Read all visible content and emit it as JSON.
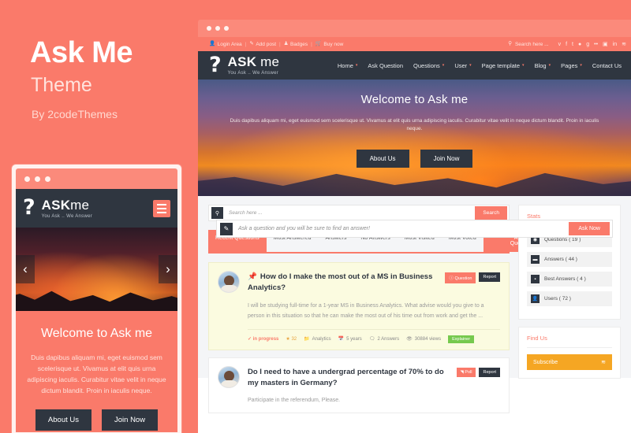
{
  "promo": {
    "title": "Ask Me",
    "subtitle": "Theme",
    "byline": "By 2codeThemes"
  },
  "mobile": {
    "logo_mark": "?",
    "logo_name_bold": "ASK",
    "logo_name_light": "me",
    "logo_tagline": "You Ask .. We Answer",
    "menu_icon": "hamburger-icon",
    "prev_arrow": "‹",
    "next_arrow": "›",
    "hero_title": "Welcome to Ask me",
    "hero_text": "Duis dapibus aliquam mi, eget euismod sem scelerisque ut. Vivamus at elit quis urna adipiscing iaculis. Curabitur vitae velit in neque dictum blandit. Proin in iaculis neque.",
    "btn_about": "About Us",
    "btn_join": "Join Now"
  },
  "topbar": {
    "items": [
      {
        "icon": "user-icon",
        "glyph": "👤",
        "label": "Login Area"
      },
      {
        "icon": "pencil-icon",
        "glyph": "✎",
        "label": "Add post"
      },
      {
        "icon": "badge-icon",
        "glyph": "♟",
        "label": "Badges"
      },
      {
        "icon": "cart-icon",
        "glyph": "🛒",
        "label": "Buy now"
      }
    ],
    "separator": "|",
    "search_icon": "search-icon",
    "search_placeholder": "Search here ...",
    "socials": [
      {
        "name": "twitter-icon",
        "glyph": "ᴠ"
      },
      {
        "name": "facebook-icon",
        "glyph": "f"
      },
      {
        "name": "tumblr-icon",
        "glyph": "t"
      },
      {
        "name": "dribbble-icon",
        "glyph": "●"
      },
      {
        "name": "google-plus-icon",
        "glyph": "g"
      },
      {
        "name": "flickr-icon",
        "glyph": "••"
      },
      {
        "name": "instagram-icon",
        "glyph": "▣"
      },
      {
        "name": "linkedin-icon",
        "glyph": "in"
      },
      {
        "name": "rss-icon",
        "glyph": "≋"
      }
    ]
  },
  "nav": {
    "logo_mark": "?",
    "logo_name_bold": "ASK",
    "logo_name_light": "me",
    "logo_tagline": "You Ask .. We Answer",
    "menu": [
      {
        "label": "Home",
        "caret": true
      },
      {
        "label": "Ask Question",
        "caret": false
      },
      {
        "label": "Questions",
        "caret": true
      },
      {
        "label": "User",
        "caret": true
      },
      {
        "label": "Page template",
        "caret": true
      },
      {
        "label": "Blog",
        "caret": true
      },
      {
        "label": "Pages",
        "caret": true
      },
      {
        "label": "Contact Us",
        "caret": false
      }
    ],
    "caret_glyph": "▾"
  },
  "hero": {
    "title": "Welcome to Ask me",
    "text": "Duis dapibus aliquam mi, eget euismod sem scelerisque ut. Vivamus at elit quis urna adipiscing iaculis. Curabitur vitae velit in neque dictum blandit. Proin in iaculis neque.",
    "btn_about": "About Us",
    "btn_join": "Join Now"
  },
  "askbar": {
    "icon": "pencil-icon",
    "glyph": "✎",
    "placeholder": "Ask a question and you will be sure to find an answer!",
    "button": "Ask Now"
  },
  "search": {
    "icon": "search-icon",
    "glyph": "⚲",
    "placeholder": "Search here ...",
    "button": "Search"
  },
  "tabs": {
    "items": [
      {
        "label": "Recent Questions",
        "active": true
      },
      {
        "label": "Most Answered",
        "active": false
      },
      {
        "label": "Answers",
        "active": false
      },
      {
        "label": "No Answers",
        "active": false
      },
      {
        "label": "Most Visited",
        "active": false
      },
      {
        "label": "Most Voted",
        "active": false
      }
    ],
    "ask_button": "Ask A Question"
  },
  "questions": [
    {
      "pin": "📌",
      "title": "How do I make the most out of a MS in Business Analytics?",
      "badges": [
        {
          "label": "Question",
          "type": "question",
          "glyph": "❗"
        },
        {
          "label": "Report",
          "type": "report"
        }
      ],
      "excerpt": "I will be studying full-time for a 1-year MS in Business Analytics. What advise would you give to a person in this situation so that he can make the most out of his time out from work and get the ...",
      "meta": {
        "status": "in progress",
        "status_glyph": "✓",
        "votes": "32",
        "votes_glyph": "★",
        "category": "Analytics",
        "category_glyph": "■",
        "age": "5 years",
        "age_glyph": "☲",
        "answers": "2 Answers",
        "answers_glyph": "⚑",
        "views": "30884 views",
        "views_glyph": "◉",
        "tag": "Explainer"
      },
      "featured": true
    },
    {
      "pin": "",
      "title": "Do I need to have a undergrad percentage of 70% to do my masters in Germany?",
      "badges": [
        {
          "label": "Poll",
          "type": "poll",
          "glyph": "◥"
        },
        {
          "label": "Report",
          "type": "report"
        }
      ],
      "excerpt": "Participate in the referendum, Please.",
      "featured": false
    }
  ],
  "sidebar": {
    "stats_title": "Stats",
    "stats": [
      {
        "icon": "question-circle-icon",
        "glyph": "◉",
        "label": "Questions ( 19 )"
      },
      {
        "icon": "comment-icon",
        "glyph": "▬",
        "label": "Answers ( 44 )"
      },
      {
        "icon": "check-square-icon",
        "glyph": "▪",
        "label": "Best Answers ( 4 )"
      },
      {
        "icon": "users-icon",
        "glyph": "👤",
        "label": "Users ( 72 )"
      }
    ],
    "find_us_title": "Find Us",
    "subscribe_label": "Subscribe",
    "subscribe_icon": "rss-icon",
    "subscribe_glyph": "≋"
  },
  "colors": {
    "brand": "#fa7a6a",
    "dark": "#2f3640",
    "featured_card": "#fbfbe0",
    "green_tag": "#76c94e",
    "orange_subscribe": "#f5a623"
  }
}
